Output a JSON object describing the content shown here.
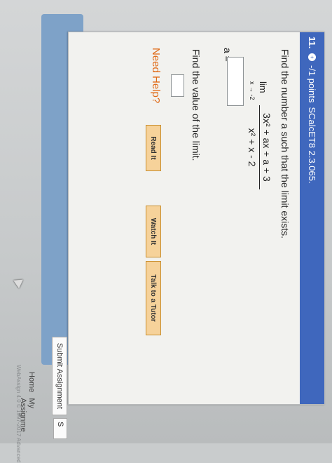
{
  "question": {
    "number": "11.",
    "icon": "info-icon",
    "points": "-/1 points",
    "source": "SCalcET8 2.3.065."
  },
  "prompt": "Find the number a such that the limit exists.",
  "limit": {
    "label": "lim",
    "approach": "x → -2",
    "numerator": "3x² + ax + a + 3",
    "denominator": "x² + x - 2"
  },
  "a_label": "a =",
  "a_value": "",
  "prompt2": "Find the value of the limit.",
  "value_answer": "",
  "need_help": "Need Help?",
  "help_buttons": [
    "Read It",
    "Watch It",
    "Talk to a Tutor"
  ],
  "submit_label": "Submit Assignment",
  "submit2_label": "S",
  "nav": [
    "Home",
    "My Assignme"
  ],
  "footer": "WebAssign 4.0 © 1997-2017 Advanced"
}
